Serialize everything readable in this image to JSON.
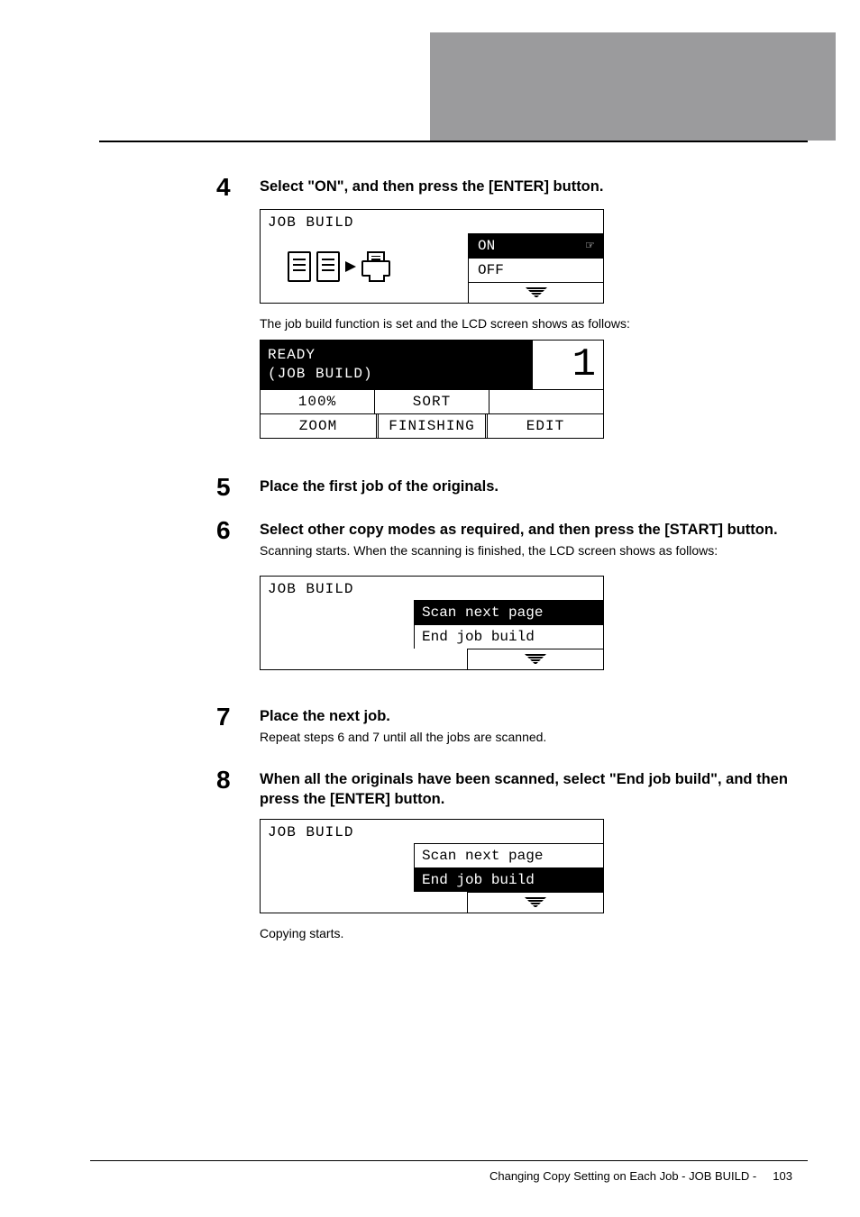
{
  "step4": {
    "num": "4",
    "head": "Select \"ON\", and then press the [ENTER] button.",
    "panel_title": "JOB BUILD",
    "opt_on": "ON",
    "opt_off": "OFF",
    "caption": "The job build function is set and the LCD screen shows as follows:",
    "ready_line1": "READY",
    "ready_line2": "(JOB BUILD)",
    "ready_big": "1",
    "row1_c1": "100%",
    "row1_c2": "SORT",
    "row1_c3": "",
    "row2_c1": "ZOOM",
    "row2_c2": "FINISHING",
    "row2_c3": "EDIT"
  },
  "step5": {
    "num": "5",
    "head": "Place the first job of the originals."
  },
  "step6": {
    "num": "6",
    "head": "Select other copy modes as required, and then press the [START] button.",
    "text": "Scanning starts. When the scanning is finished, the LCD screen shows as follows:",
    "panel_title": "JOB BUILD",
    "item1": "Scan next page",
    "item2": "End job build"
  },
  "step7": {
    "num": "7",
    "head": "Place the next job.",
    "text": "Repeat steps 6 and 7 until all the jobs are scanned."
  },
  "step8": {
    "num": "8",
    "head": "When all the originals have been scanned, select \"End job build\", and then press the [ENTER] button.",
    "panel_title": "JOB BUILD",
    "item1": "Scan next page",
    "item2": "End job build",
    "caption": "Copying starts."
  },
  "footer": {
    "text": "Changing Copy Setting on Each Job - JOB BUILD -",
    "page": "103"
  }
}
